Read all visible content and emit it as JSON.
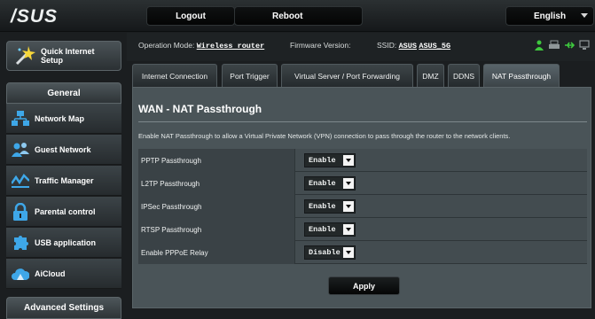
{
  "header": {
    "logo_text": "/SUS",
    "logout_label": "Logout",
    "reboot_label": "Reboot",
    "language": "English"
  },
  "status_bar": {
    "mode_label": "Operation Mode:",
    "mode_value": "Wireless router",
    "firmware_label": "Firmware Version:",
    "ssid_label": "SSID:",
    "ssid_1": "ASUS",
    "ssid_2": "ASUS_5G",
    "icons": [
      "usb-person-icon",
      "printer-icon",
      "usb-icon",
      "network-icon"
    ],
    "icon_accent": "#3ec83e"
  },
  "sidebar": {
    "quick_setup_label": "Quick Internet Setup",
    "general_header": "General",
    "advanced_header": "Advanced Settings",
    "items": [
      {
        "label": "Network Map",
        "icon": "network-map-icon"
      },
      {
        "label": "Guest Network",
        "icon": "guest-network-icon"
      },
      {
        "label": "Traffic Manager",
        "icon": "traffic-manager-icon"
      },
      {
        "label": "Parental control",
        "icon": "parental-control-icon"
      },
      {
        "label": "USB application",
        "icon": "usb-application-icon"
      },
      {
        "label": "AiCloud",
        "icon": "aicloud-icon"
      }
    ]
  },
  "tabs": [
    {
      "label": "Internet Connection"
    },
    {
      "label": "Port Trigger"
    },
    {
      "label": "Virtual Server / Port Forwarding"
    },
    {
      "label": "DMZ"
    },
    {
      "label": "DDNS"
    },
    {
      "label": "NAT Passthrough",
      "active": true
    }
  ],
  "panel": {
    "title": "WAN - NAT Passthrough",
    "description": "Enable NAT Passthrough to allow a Virtual Private Network (VPN) connection to pass through the router to the network clients.",
    "settings": [
      {
        "name": "PPTP Passthrough",
        "value": "Enable"
      },
      {
        "name": "L2TP Passthrough",
        "value": "Enable"
      },
      {
        "name": "IPSec Passthrough",
        "value": "Enable"
      },
      {
        "name": "RTSP Passthrough",
        "value": "Enable"
      },
      {
        "name": "Enable PPPoE Relay",
        "value": "Disable"
      }
    ],
    "apply_label": "Apply"
  }
}
